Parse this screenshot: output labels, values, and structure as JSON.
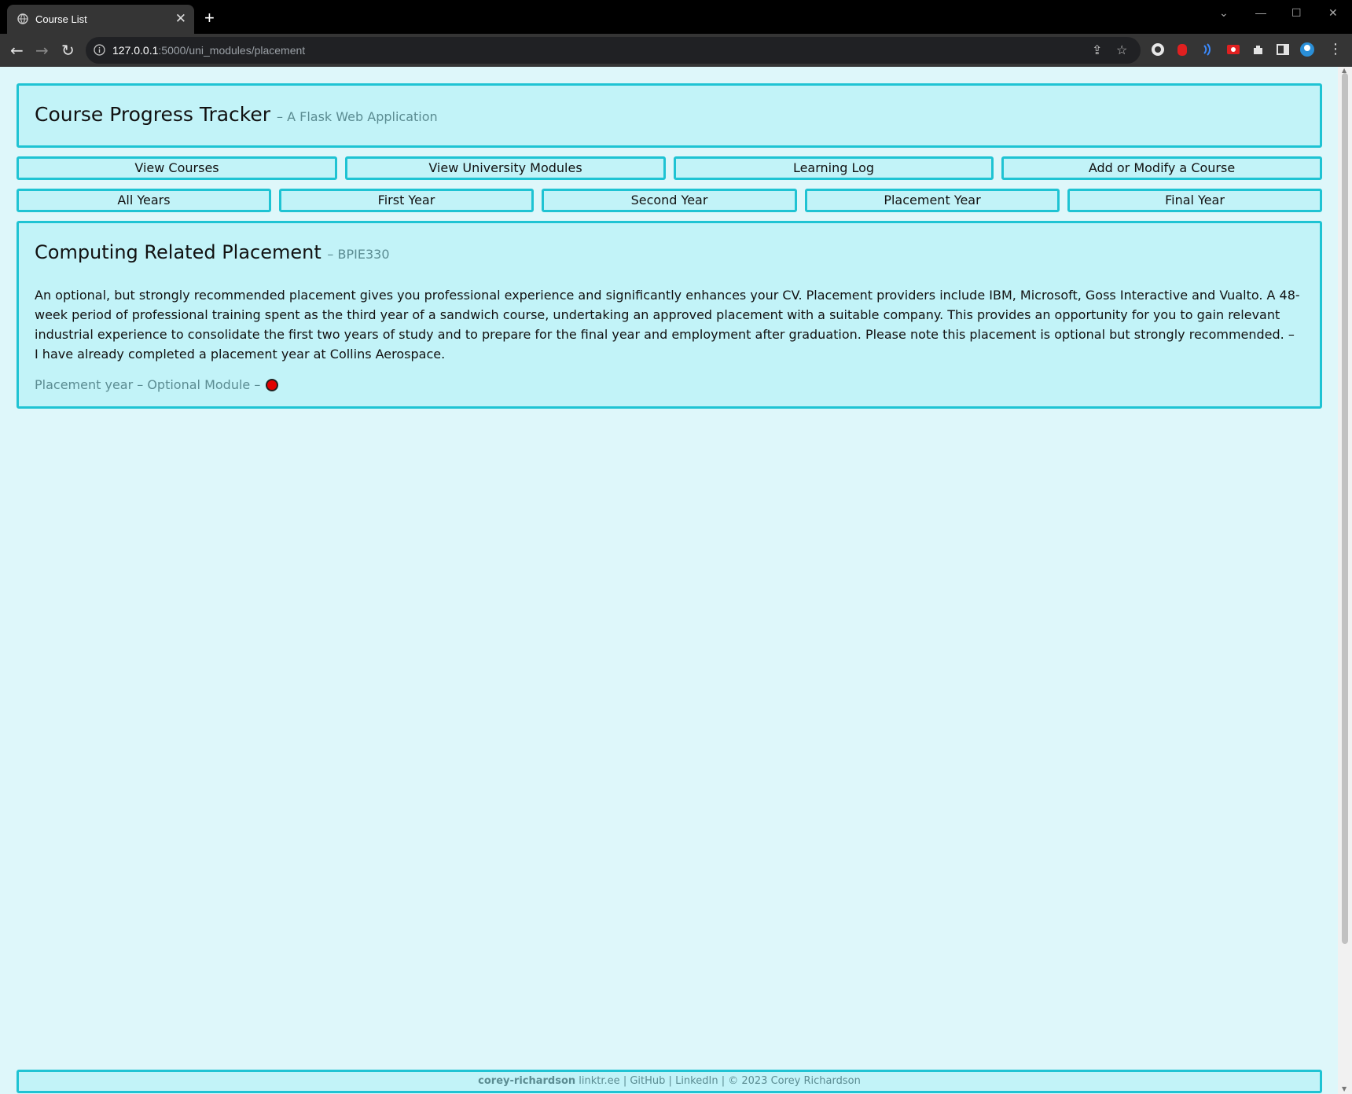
{
  "browser": {
    "tab_title": "Course List",
    "tab_close": "✕",
    "new_tab": "+",
    "url_host": "127.0.0.1",
    "url_path": ":5000/uni_modules/placement"
  },
  "header": {
    "title": "Course Progress Tracker",
    "subtitle": "– A Flask Web Application"
  },
  "nav": {
    "view_courses": "View Courses",
    "view_modules": "View University Modules",
    "learning_log": "Learning Log",
    "add_modify": "Add or Modify a Course"
  },
  "years": {
    "all": "All Years",
    "first": "First Year",
    "second": "Second Year",
    "placement": "Placement Year",
    "final": "Final Year"
  },
  "module": {
    "title": "Computing Related Placement",
    "code": "– BPIE330",
    "description": "An optional, but strongly recommended placement gives you professional experience and significantly enhances your CV. Placement providers include IBM, Microsoft, Goss Interactive and Vualto. A 48-week period of professional training spent as the third year of a sandwich course, undertaking an approved placement with a suitable company. This provides an opportunity for you to gain relevant industrial experience to consolidate the first two years of study and to prepare for the final year and employment after graduation. Please note this placement is optional but strongly recommended. – I have already completed a placement year at Collins Aerospace.",
    "meta": "Placement year – Optional Module –",
    "status_color": "#e00000"
  },
  "footer": {
    "user": "corey-richardson",
    "linktree": "linktr.ee",
    "github": "GitHub",
    "linkedin": "LinkedIn",
    "copyright": "© 2023 Corey Richardson",
    "sep": "|"
  }
}
